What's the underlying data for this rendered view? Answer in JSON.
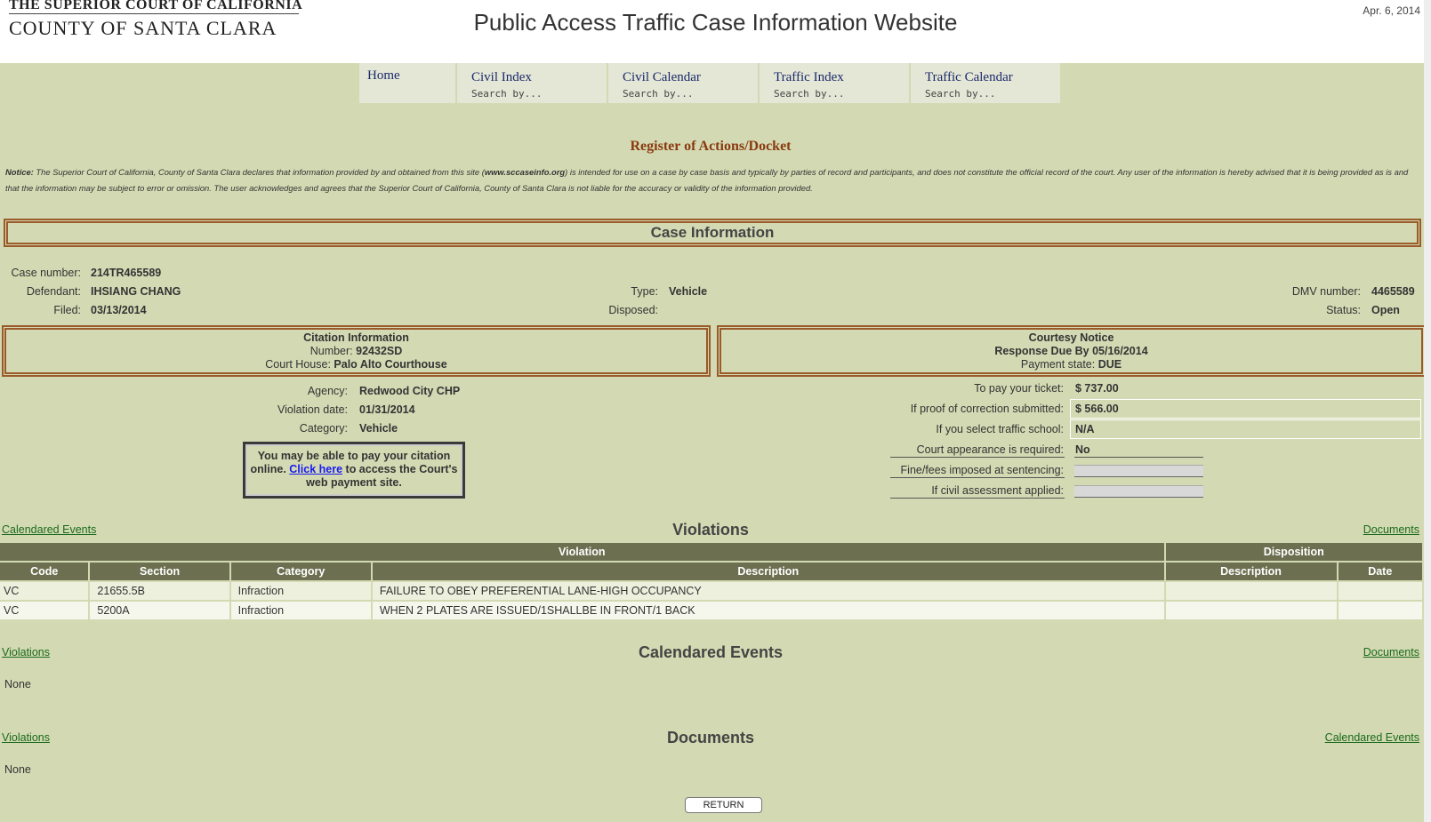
{
  "header": {
    "logo_line1": "THE SUPERIOR COURT OF CALIFORNIA",
    "logo_line2": "COUNTY OF SANTA CLARA",
    "title": "Public Access Traffic Case Information Website",
    "date": "Apr. 6, 2014"
  },
  "nav": {
    "tabs": [
      {
        "label": "Home",
        "sub": ""
      },
      {
        "label": "Civil Index",
        "sub": "Search by..."
      },
      {
        "label": "Civil Calendar",
        "sub": "Search by..."
      },
      {
        "label": "Traffic Index",
        "sub": "Search by..."
      },
      {
        "label": "Traffic Calendar",
        "sub": "Search by..."
      }
    ]
  },
  "page_title": "Register of Actions/Docket",
  "notice": {
    "label": "Notice:",
    "text1": "The Superior Court of California, County of Santa Clara declares that information provided by and obtained from this site (",
    "site": "www.sccaseinfo.org",
    "text2": ") is intended for use on a case by case basis and typically by parties of record and participants, and does not constitute the official record of the court.  Any user of the information is hereby advised that it is being provided as is and that the information may be subject to error or omission.  The user acknowledges and agrees that the Superior Court of California, County of Santa Clara is not liable for the accuracy or validity of the information provided."
  },
  "case": {
    "section_title": "Case Information",
    "case_number_label": "Case number:",
    "case_number": "214TR465589",
    "defendant_label": "Defendant:",
    "defendant": "IHSIANG CHANG",
    "filed_label": "Filed:",
    "filed": "03/13/2014",
    "type_label": "Type:",
    "type": "Vehicle",
    "disposed_label": "Disposed:",
    "disposed": "",
    "dmv_label": "DMV number:",
    "dmv": "4465589",
    "status_label": "Status:",
    "status": "Open"
  },
  "citation": {
    "title": "Citation Information",
    "number_label": "Number:",
    "number": "92432SD",
    "courthouse_label": "Court House:",
    "courthouse": "Palo Alto Courthouse",
    "agency_label": "Agency:",
    "agency": "Redwood City CHP",
    "violation_date_label": "Violation date:",
    "violation_date": "01/31/2014",
    "category_label": "Category:",
    "category": "Vehicle"
  },
  "pay_online": {
    "text1": "You may be able to pay your citation online.",
    "link": "Click here",
    "text2": "to access the Court's web payment site."
  },
  "courtesy": {
    "title": "Courtesy Notice",
    "response_label": "Response Due By",
    "response_date": "05/16/2014",
    "payment_label": "Payment state:",
    "payment_state": "DUE"
  },
  "fees": {
    "pay_label": "To pay your ticket:",
    "pay": "$ 737.00",
    "proof_label": "If proof of correction submitted:",
    "proof": "$ 566.00",
    "school_label": "If you select traffic school:",
    "school": "N/A",
    "appearance_label": "Court appearance is required:",
    "appearance": "No",
    "fines_label": "Fine/fees imposed at sentencing:",
    "civil_label": "If civil assessment applied:"
  },
  "violations": {
    "title": "Violations",
    "left_link": "Calendared Events",
    "right_link": "Documents",
    "group_violation": "Violation",
    "group_disposition": "Disposition",
    "columns": [
      "Code",
      "Section",
      "Category",
      "Description",
      "Description",
      "Date"
    ],
    "rows": [
      [
        "VC",
        "21655.5B",
        "Infraction",
        "FAILURE TO OBEY PREFERENTIAL LANE-HIGH OCCUPANCY",
        "",
        ""
      ],
      [
        "VC",
        "5200A",
        "Infraction",
        "WHEN 2 PLATES ARE ISSUED/1SHALLBE IN FRONT/1 BACK",
        "",
        ""
      ]
    ]
  },
  "calendared": {
    "title": "Calendared Events",
    "left_link": "Violations",
    "right_link": "Documents",
    "content": "None"
  },
  "documents": {
    "title": "Documents",
    "left_link": "Violations",
    "right_link": "Calendared Events",
    "content": "None"
  },
  "return_button": "RETURN"
}
